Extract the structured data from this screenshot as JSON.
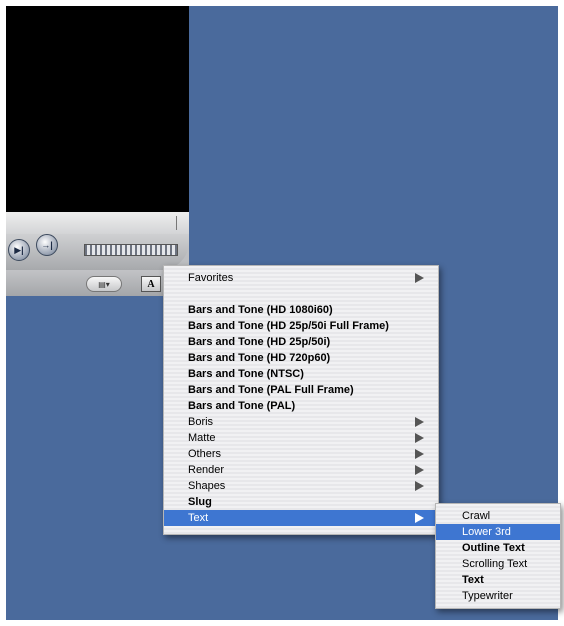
{
  "viewer": {
    "play_in_out_icon": "play-in-to-out-icon",
    "mark_icon": "go-to-out-icon",
    "play_in_out_glyph": "▶|",
    "mark_glyph": "→|",
    "generator_button_glyph": "A"
  },
  "main_menu": {
    "items": [
      {
        "label": "Favorites",
        "bold": false,
        "submenu": true
      },
      {
        "label": "Bars and Tone (HD 1080i60)",
        "bold": true,
        "submenu": false
      },
      {
        "label": "Bars and Tone (HD 25p/50i Full Frame)",
        "bold": true,
        "submenu": false
      },
      {
        "label": "Bars and Tone (HD 25p/50i)",
        "bold": true,
        "submenu": false
      },
      {
        "label": "Bars and Tone (HD 720p60)",
        "bold": true,
        "submenu": false
      },
      {
        "label": "Bars and Tone (NTSC)",
        "bold": true,
        "submenu": false
      },
      {
        "label": "Bars and Tone (PAL Full Frame)",
        "bold": true,
        "submenu": false
      },
      {
        "label": "Bars and Tone (PAL)",
        "bold": true,
        "submenu": false
      },
      {
        "label": "Boris",
        "bold": false,
        "submenu": true
      },
      {
        "label": "Matte",
        "bold": false,
        "submenu": true
      },
      {
        "label": "Others",
        "bold": false,
        "submenu": true
      },
      {
        "label": "Render",
        "bold": false,
        "submenu": true
      },
      {
        "label": "Shapes",
        "bold": false,
        "submenu": true
      },
      {
        "label": "Slug",
        "bold": true,
        "submenu": false
      },
      {
        "label": "Text",
        "bold": false,
        "submenu": true,
        "highlighted": true
      }
    ]
  },
  "text_submenu": {
    "items": [
      {
        "label": "Crawl",
        "bold": false
      },
      {
        "label": "Lower 3rd",
        "bold": false,
        "highlighted": true
      },
      {
        "label": "Outline Text",
        "bold": true
      },
      {
        "label": "Scrolling Text",
        "bold": false
      },
      {
        "label": "Text",
        "bold": true
      },
      {
        "label": "Typewriter",
        "bold": false
      }
    ]
  },
  "colors": {
    "desktop": "#4a6a9c",
    "highlight": "#3e76d1"
  }
}
